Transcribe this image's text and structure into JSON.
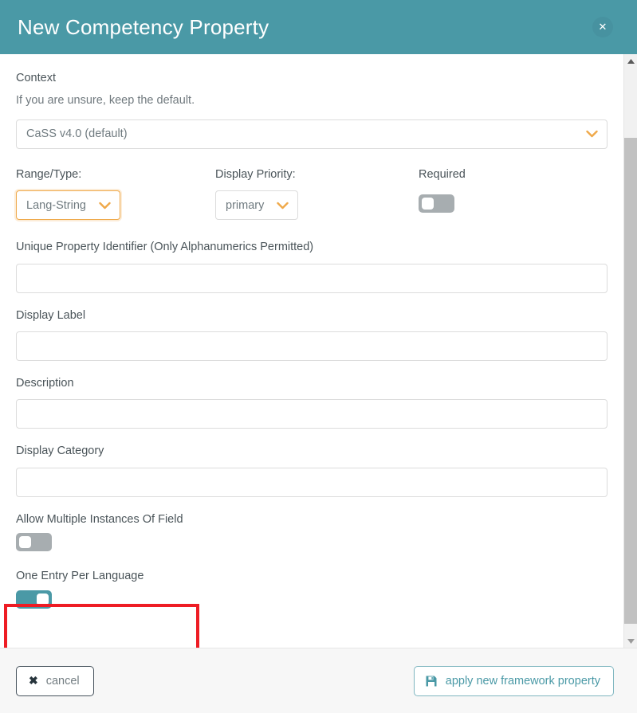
{
  "header": {
    "title": "New Competency Property",
    "close_label": "✕"
  },
  "form": {
    "context": {
      "label": "Context",
      "helper": "If you are unsure, keep the default.",
      "selected": "CaSS v4.0 (default)"
    },
    "range_type": {
      "label": "Range/Type:",
      "selected": "Lang-String",
      "focused": true
    },
    "display_priority": {
      "label": "Display Priority:",
      "selected": "primary",
      "focused": false
    },
    "required": {
      "label": "Required",
      "on": false
    },
    "unique_identifier": {
      "label": "Unique Property Identifier (Only Alphanumerics Permitted)",
      "value": "",
      "placeholder": ""
    },
    "display_label": {
      "label": "Display Label",
      "value": "",
      "placeholder": ""
    },
    "description": {
      "label": "Description",
      "value": "",
      "placeholder": ""
    },
    "display_category": {
      "label": "Display Category",
      "value": "",
      "placeholder": ""
    },
    "allow_multiple": {
      "label": "Allow Multiple Instances Of Field",
      "on": false
    },
    "one_entry_per_language": {
      "label": "One Entry Per Language",
      "on": true,
      "highlighted": true
    }
  },
  "footer": {
    "cancel_label": "cancel",
    "cancel_icon": "close-x-icon",
    "apply_label": "apply new framework property",
    "apply_icon": "save-floppy-icon"
  },
  "colors": {
    "header_teal": "#4a99a6",
    "toggle_on": "#4a99a6",
    "toggle_off": "#a7adb0",
    "chevron_orange": "#efa94a",
    "focus_border_orange": "#efa94a",
    "annotation_red": "#ee1c24",
    "apply_text": "#4a99a6"
  },
  "scrollbar": {
    "up_arrow": "scroll-up-arrow",
    "down_arrow": "scroll-down-arrow"
  }
}
